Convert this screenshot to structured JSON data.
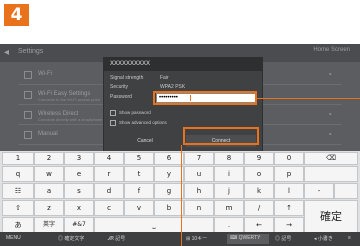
{
  "step_number": "4",
  "topbar": {
    "title": "Settings",
    "home_label": "Home Screen"
  },
  "settings_rows": [
    {
      "label": "Wi-Fi"
    },
    {
      "label": "Wi-Fi Easy Settings",
      "sub": "Connects to the Wi-Fi access point"
    },
    {
      "label": "Wireless Direct",
      "sub": "Connects directly with a smartphone"
    },
    {
      "label": "Manual"
    }
  ],
  "dialog": {
    "title": "XXXXXXXXXX",
    "signal_strength_label": "Signal strength",
    "signal_strength_value": "Fair",
    "security_label": "Security",
    "security_value": "WPA2 PSK",
    "password_label": "Password",
    "password_value": "•••••••••",
    "show_password": "Show password",
    "show_advanced": "Show advanced options",
    "cancel_label": "Cancel",
    "connect_label": "Connect"
  },
  "ssid_behind": "XXXXXXXX XXXXXXXXXX",
  "keyboard": {
    "row_numbers": [
      "1",
      "2",
      "3",
      "4",
      "5",
      "6",
      "7",
      "8",
      "9",
      "0"
    ],
    "row_q": [
      "q",
      "w",
      "e",
      "r",
      "t",
      "y",
      "u",
      "i",
      "o",
      "p"
    ],
    "row_a": [
      "a",
      "s",
      "d",
      "f",
      "g",
      "h",
      "j",
      "k",
      "l",
      "-"
    ],
    "row_z": [
      "z",
      "x",
      "c",
      "v",
      "b",
      "n",
      "m",
      "/",
      "↑"
    ],
    "backspace": "⌫",
    "shift": "⇧",
    "mode": "あ",
    "symbols": "英字",
    "sym2": "#&7",
    "space": "⎵",
    "dot": ".",
    "left": "←",
    "right": "→",
    "confirm": "確定",
    "layout_icon": "☷"
  },
  "bottombar": {
    "menu": "MENU",
    "item1": "◎ 確定文字",
    "item2": "ᏗᏒ 記号",
    "item3": "⊞ 10キー",
    "item4": "⌨ QWERTY",
    "item5": "◎ 記号",
    "item6": "◂ 小書き",
    "item7": "≡"
  }
}
